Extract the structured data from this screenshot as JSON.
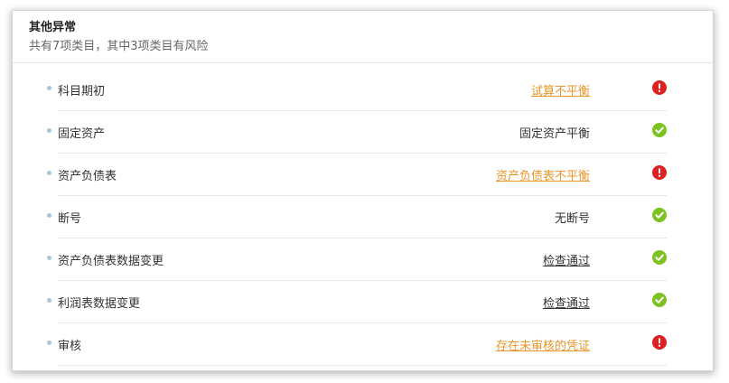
{
  "header": {
    "title": "其他异常",
    "subtitle": "共有7项类目，其中3项类目有风险"
  },
  "colors": {
    "warn_text": "#e8962a",
    "error_icon": "#e02020",
    "ok_icon": "#7cc221",
    "bullet": "#a9c6d9"
  },
  "items": [
    {
      "label": "科目期初",
      "status": "试算不平衡",
      "status_style": "warn",
      "icon": "error-icon"
    },
    {
      "label": "固定资产",
      "status": "固定资产平衡",
      "status_style": "plain",
      "icon": "check-icon"
    },
    {
      "label": "资产负债表",
      "status": "资产负债表不平衡",
      "status_style": "warn",
      "icon": "error-icon"
    },
    {
      "label": "断号",
      "status": "无断号",
      "status_style": "plain",
      "icon": "check-icon"
    },
    {
      "label": "资产负债表数据变更",
      "status": "检查通过",
      "status_style": "link",
      "icon": "check-icon"
    },
    {
      "label": "利润表数据变更",
      "status": "检查通过",
      "status_style": "link",
      "icon": "check-icon"
    },
    {
      "label": "审核",
      "status": "存在未审核的凭证",
      "status_style": "warn",
      "icon": "error-icon"
    }
  ]
}
